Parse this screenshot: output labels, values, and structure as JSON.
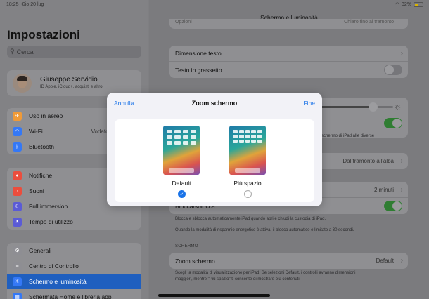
{
  "status": {
    "time": "18:25",
    "date": "Gio 20 lug",
    "battery": "32%"
  },
  "sidebar": {
    "title": "Impostazioni",
    "search_placeholder": "Cerca",
    "profile": {
      "name": "Giuseppe Servidio",
      "subtitle": "ID Apple, iCloud+, acquisti e altro"
    },
    "group1": [
      {
        "label": "Uso in aereo",
        "icon": "airplane-icon",
        "color": "#f09a37"
      },
      {
        "label": "Wi-Fi",
        "icon": "wifi-icon",
        "color": "#3478f6",
        "value": "Vodafone di Giuse"
      },
      {
        "label": "Bluetooth",
        "icon": "bluetooth-icon",
        "color": "#3478f6"
      }
    ],
    "group2": [
      {
        "label": "Notifiche",
        "icon": "bell-icon",
        "color": "#eb4d3d"
      },
      {
        "label": "Suoni",
        "icon": "speaker-icon",
        "color": "#eb4d3d"
      },
      {
        "label": "Full immersion",
        "icon": "moon-icon",
        "color": "#5b5bd6"
      },
      {
        "label": "Tempo di utilizzo",
        "icon": "hourglass-icon",
        "color": "#5b5bd6"
      }
    ],
    "group3": [
      {
        "label": "Generali",
        "icon": "gear-icon",
        "color": "#8e8e93"
      },
      {
        "label": "Centro di Controllo",
        "icon": "sliders-icon",
        "color": "#8e8e93"
      },
      {
        "label": "Schermo e luminosità",
        "icon": "brightness-icon",
        "color": "#3478f6",
        "selected": true
      },
      {
        "label": "Schermata Home e libreria app",
        "icon": "grid-icon",
        "color": "#3478f6"
      }
    ]
  },
  "detail": {
    "title": "Schermo e luminosità",
    "text_group": {
      "row1": "Dimensione testo",
      "row2": "Testo in grassetto"
    },
    "partial_top_row": "Opzioni",
    "partial_top_value": "Chiaro fino al tramonto",
    "true_tone_note": "schermo di iPad alle diverse",
    "night_shift_value": "Dal tramonto all'alba",
    "autolock_value": "2 minuti",
    "lock_row": "Blocca/sblocca",
    "lock_note1": "Blocca e sblocca automaticamente iPad quando apri e chiudi la custodia di iPad.",
    "lock_note2": "Quando la modalità di risparmio energetico è attiva, il blocco automatico è limitato a 30 secondi.",
    "section_schermo": "SCHERMO",
    "zoom_row": "Zoom schermo",
    "zoom_value": "Default",
    "zoom_note1": "Scegli la modalità di visualizzazione per iPad. Se selezioni Default, i controlli avranno dimensioni",
    "zoom_note2": "maggiori, mentre \"Più spazio\" ti consente di mostrare più contenuti.",
    "brightness": 0.72
  },
  "modal": {
    "cancel": "Annulla",
    "title": "Zoom schermo",
    "done": "Fine",
    "options": [
      {
        "label": "Default",
        "selected": true
      },
      {
        "label": "Più spazio",
        "selected": false
      }
    ]
  },
  "accent": "#1a73e8"
}
